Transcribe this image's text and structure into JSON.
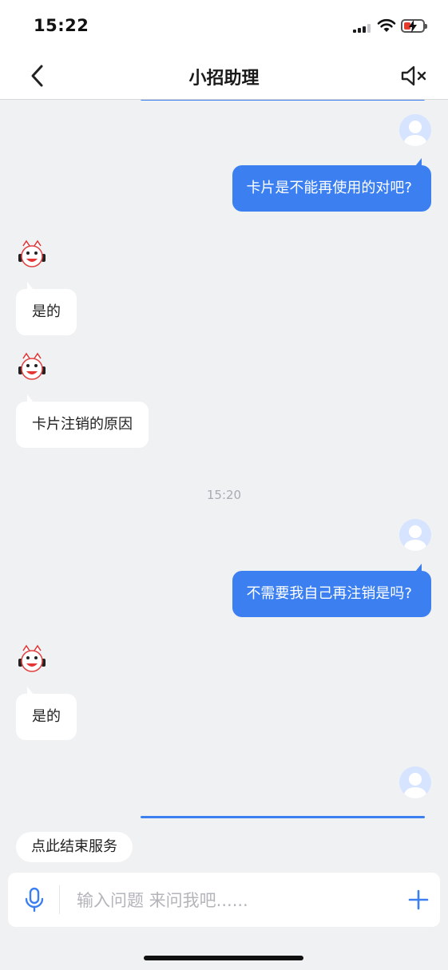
{
  "status": {
    "time": "15:22"
  },
  "nav": {
    "title": "小招助理",
    "back_icon": "chevron-left-icon",
    "mute_icon": "speaker-mute-icon"
  },
  "colors": {
    "accent": "#3b7ff0",
    "background": "#f0f1f3",
    "battery_low": "#e53b2c"
  },
  "messages": [
    {
      "from": "user",
      "text": "卡片是不能再使用的对吧?"
    },
    {
      "from": "bot",
      "text": "是的"
    },
    {
      "from": "bot",
      "text": "卡片注销的原因"
    },
    {
      "type": "timestamp",
      "text": "15:20"
    },
    {
      "from": "user",
      "text": "不需要我自己再注销是吗?"
    },
    {
      "from": "bot",
      "text": "是的"
    }
  ],
  "footer": {
    "end_service_label": "点此结束服务",
    "input_placeholder": "输入问题 来问我吧......",
    "mic_icon": "microphone-icon",
    "plus_icon": "plus-icon"
  }
}
